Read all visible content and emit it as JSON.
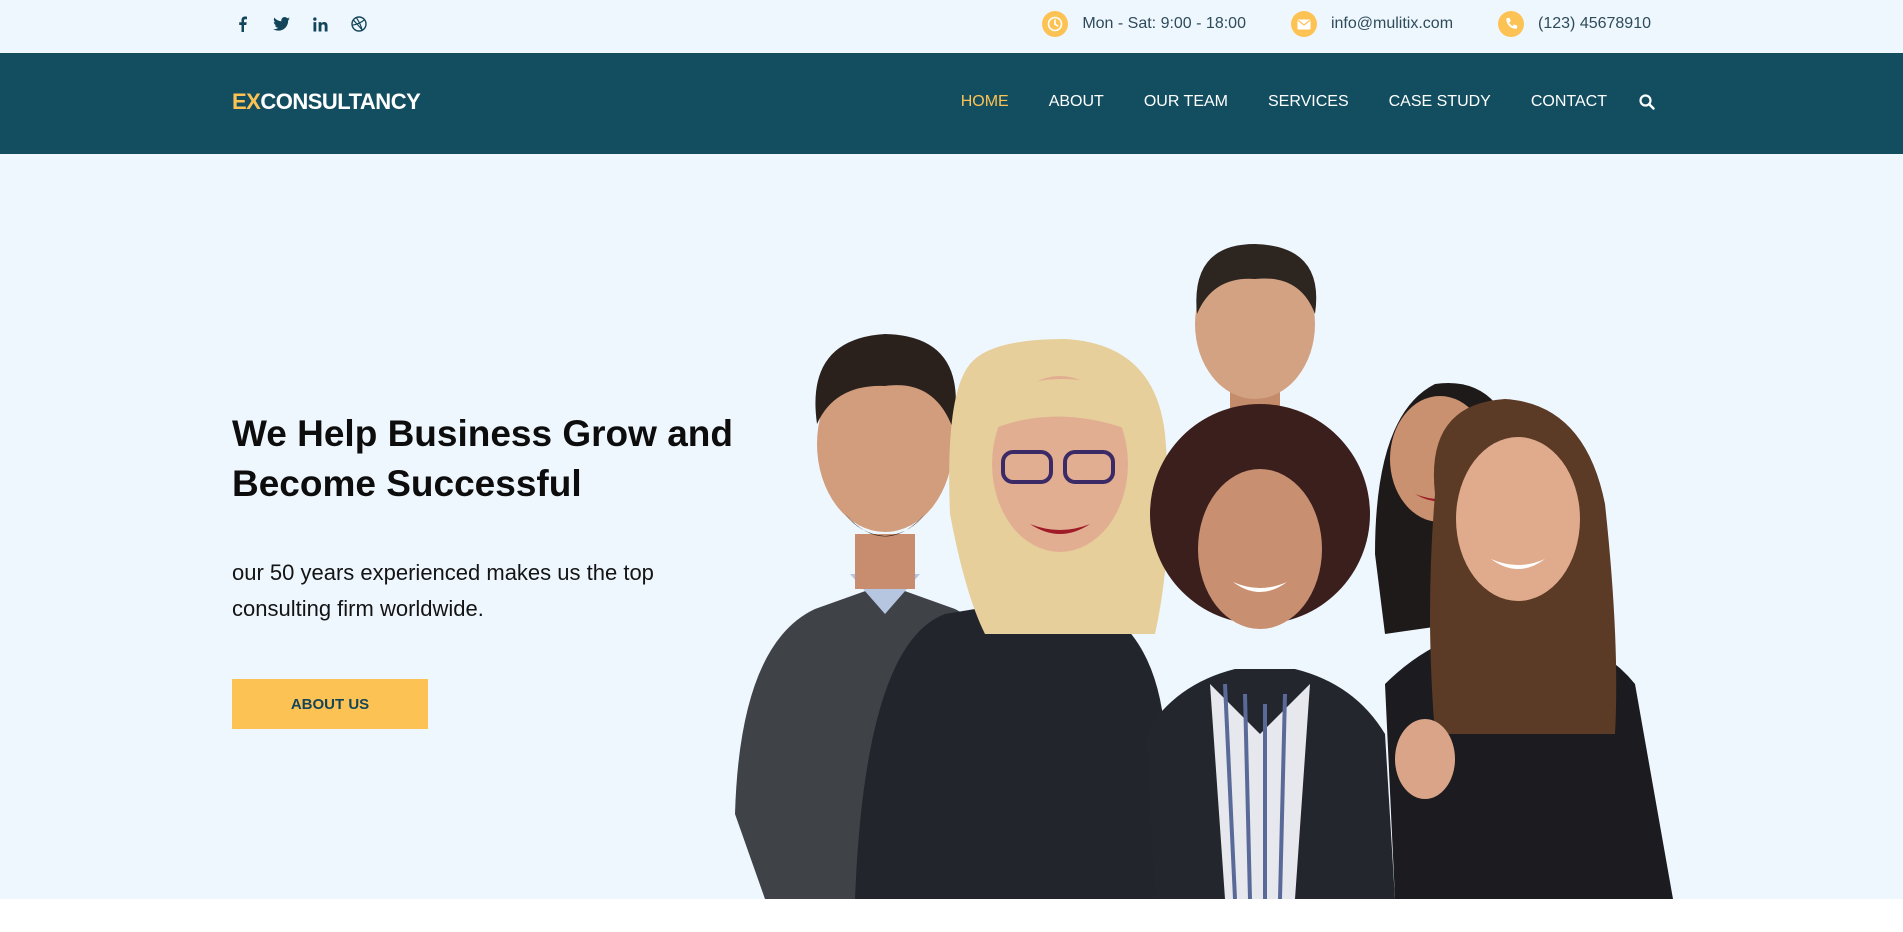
{
  "colors": {
    "brand_dark": "#134e60",
    "accent_yellow": "#fcc354",
    "hero_bg": "#eff7fe"
  },
  "topbar": {
    "social_icons": [
      "facebook-icon",
      "twitter-icon",
      "linkedin-icon",
      "dribbble-icon"
    ],
    "hours": "Mon - Sat: 9:00 - 18:00",
    "email": "info@mulitix.com",
    "phone": "(123) 45678910"
  },
  "nav": {
    "logo_ex": "EX",
    "logo_rest": "CONSULTANCY",
    "items": [
      {
        "label": "HOME",
        "active": true
      },
      {
        "label": "ABOUT",
        "active": false
      },
      {
        "label": "OUR TEAM",
        "active": false
      },
      {
        "label": "SERVICES",
        "active": false
      },
      {
        "label": "CASE STUDY",
        "active": false
      },
      {
        "label": "CONTACT",
        "active": false
      }
    ]
  },
  "hero": {
    "headline": "We Help Business Grow and Become Successful",
    "subtitle": "our 50 years experienced makes us the top consulting firm worldwide.",
    "button_label": "ABOUT US"
  }
}
